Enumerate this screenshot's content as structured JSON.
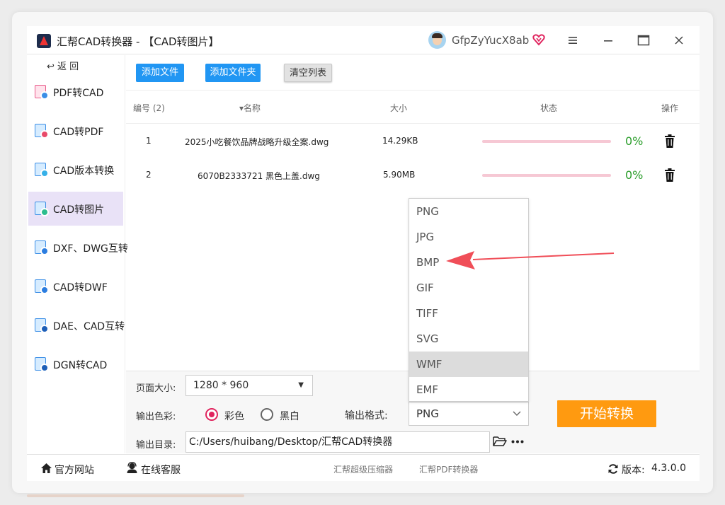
{
  "window": {
    "title": "汇帮CAD转换器 - 【CAD转图片】",
    "username": "GfpZyYucX8ab"
  },
  "sidebar": {
    "back_label": "↩  返 回",
    "items": [
      {
        "label": "PDF转CAD"
      },
      {
        "label": "CAD转PDF"
      },
      {
        "label": "CAD版本转换"
      },
      {
        "label": "CAD转图片"
      },
      {
        "label": "DXF、DWG互转"
      },
      {
        "label": "CAD转DWF"
      },
      {
        "label": "DAE、CAD互转"
      },
      {
        "label": "DGN转CAD"
      }
    ],
    "active_index": 3
  },
  "toolbar": {
    "add_file": "添加文件",
    "add_folder": "添加文件夹",
    "clear_list": "清空列表"
  },
  "table": {
    "headers": {
      "number": "编号 (2)",
      "name": "▾名称",
      "size": "大小",
      "status": "状态",
      "action": "操作"
    },
    "rows": [
      {
        "no": "1",
        "name": "2025小吃餐饮品牌战略升级全案.dwg",
        "size": "14.29KB",
        "progress": 0,
        "pct": "0%"
      },
      {
        "no": "2",
        "name": "6070B2333721 黑色上盖.dwg",
        "size": "5.90MB",
        "progress": 0,
        "pct": "0%"
      }
    ]
  },
  "format_dropdown": {
    "options": [
      "PNG",
      "JPG",
      "BMP",
      "GIF",
      "TIFF",
      "SVG",
      "WMF",
      "EMF"
    ],
    "hovered": "WMF"
  },
  "settings": {
    "page_size_label": "页面大小:",
    "page_size_value": "1280 * 960",
    "color_label": "输出色彩:",
    "color_option_color": "彩色",
    "color_option_bw": "黑白",
    "color_selected": "彩色",
    "format_label": "输出格式:",
    "format_value": "PNG",
    "dir_label": "输出目录:",
    "dir_value": "C:/Users/huibang/Desktop/汇帮CAD转换器",
    "start_button": "开始转换"
  },
  "footer": {
    "website": "官方网站",
    "service": "在线客服",
    "link1": "汇帮超级压缩器",
    "link2": "汇帮PDF转换器",
    "version_label": "版本:",
    "version_value": "4.3.0.0"
  },
  "colors": {
    "accent_blue": "#2196f3",
    "start_orange": "#ff9a10",
    "progress_pink": "#f6c8d4",
    "percent_green": "#2a9d2a",
    "radio_red": "#e0245e",
    "active_side": "#e9e2f7"
  }
}
